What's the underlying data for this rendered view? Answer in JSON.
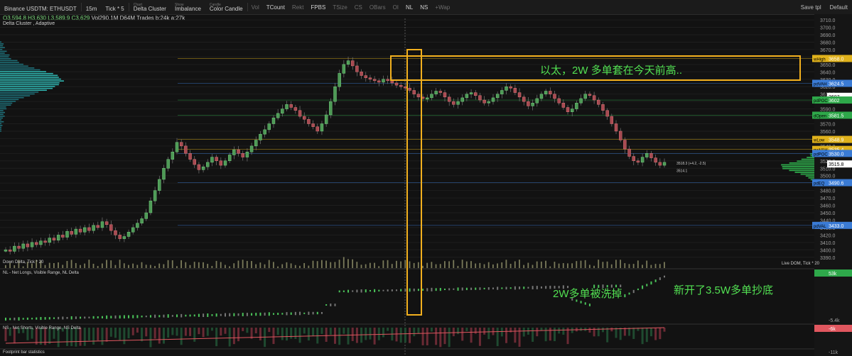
{
  "toolbar": {
    "symbol": "Binance USDTM: ETHUSDT",
    "interval": "15m",
    "tick": "Tick * 5",
    "chart_type_caption": "Chart",
    "chart_type": "Delta Cluster",
    "display_caption": "Show",
    "display": "Imbalance",
    "candle_caption": "Candle",
    "candle": "Color Candle",
    "flags": [
      "Vol",
      "TCount",
      "Rekt",
      "FPBS",
      "TSize",
      "CS",
      "OBars",
      "OI",
      "NL",
      "NS",
      "+Wap"
    ],
    "flags_active": [
      false,
      true,
      false,
      true,
      false,
      false,
      false,
      false,
      true,
      true,
      false
    ],
    "save_tpl": "Save tpl",
    "default": "Default"
  },
  "header": {
    "ohlc_o": "O3,594.8",
    "ohlc_h": "H3,630",
    "ohlc_l": "L3,589.9",
    "ohlc_c": "C3,629",
    "ohlc_vol": "Vol290.1M",
    "ohlc_d": "D64M",
    "ohlc_trades": "Trades b:24k a:27k",
    "study": "Delta Cluster , Adaptive"
  },
  "price_axis": {
    "ticks": [
      "3710.0",
      "3700.0",
      "3690.0",
      "3680.0",
      "3670.0",
      "3660.0",
      "3650.0",
      "3640.0",
      "3630.0",
      "3620.0",
      "3610.0",
      "3600.0",
      "3590.0",
      "3580.0",
      "3570.0",
      "3560.0",
      "3550.0",
      "3540.0",
      "3530.0",
      "3520.0",
      "3510.0",
      "3500.0",
      "3490.0",
      "3480.0",
      "3470.0",
      "3460.0",
      "3450.0",
      "3440.0",
      "3430.0",
      "3420.0",
      "3410.0",
      "3400.0",
      "3390.0"
    ],
    "labels": [
      {
        "text": "wHigh",
        "value": "3658.0",
        "price": 3658.0,
        "color": "#e0b21c"
      },
      {
        "text": "pdVAH",
        "value": "3624.5",
        "price": 3624.5,
        "color": "#3a7bd5"
      },
      {
        "text": "",
        "value": "3607",
        "price": 3607.0,
        "color": "#ffffff"
      },
      {
        "text": "pdPOC",
        "value": "3602",
        "price": 3602.0,
        "color": "#2ea84a"
      },
      {
        "text": "dOpen",
        "value": "3581.5",
        "price": 3581.5,
        "color": "#2ea84a"
      },
      {
        "text": "wLow",
        "value": "3548.9",
        "price": 3548.9,
        "color": "#e0b21c"
      },
      {
        "text": "pwVAH",
        "value": "3535.4",
        "price": 3535.4,
        "color": "#e0b21c"
      },
      {
        "text": "pdPOC",
        "value": "3530.0",
        "price": 3530.0,
        "color": "#3a7bd5"
      },
      {
        "text": "",
        "value": "3515.8",
        "price": 3515.8,
        "color": "#ffffff"
      },
      {
        "text": "pdEQ",
        "value": "3490.6",
        "price": 3490.6,
        "color": "#3a7bd5"
      },
      {
        "text": "pdVAL",
        "value": "3433.0",
        "price": 3433.0,
        "color": "#3a7bd5"
      }
    ],
    "last_readout": "3518.3 (+4.2, -2.5)",
    "low_readout": "3514.1"
  },
  "volume_pane": {
    "label": "Down Delta, Tick * 20",
    "dom_label": "Live DOM, Tick * 20"
  },
  "nl_pane": {
    "label": "NL - Net Longs, Visible Range, NL Delta",
    "value_top": "53k",
    "value_bottom": "-5.4k"
  },
  "ns_pane": {
    "label": "NS - Net Shorts, Visible Range, NS Delta",
    "value_top": "-6k",
    "value_bottom": "-11k"
  },
  "footer": {
    "label": "Footprint bar statistics"
  },
  "annotations": {
    "top_box_text": "以太，2W 多单套在今天前高..",
    "nl_text_1": "2W多单被洗掉",
    "nl_text_2": "新开了3.5W多单抄底",
    "box_color": "#f2b01e"
  },
  "colors": {
    "up": "#5fd16a",
    "down": "#e0575f",
    "bg": "#121212"
  },
  "chart_data": {
    "type": "candlestick",
    "y_range": [
      3385,
      3712
    ],
    "close_path": [
      3400,
      3398,
      3405,
      3402,
      3408,
      3404,
      3410,
      3407,
      3412,
      3410,
      3416,
      3413,
      3420,
      3417,
      3425,
      3421,
      3428,
      3424,
      3430,
      3426,
      3433,
      3430,
      3438,
      3434,
      3426,
      3420,
      3415,
      3418,
      3424,
      3430,
      3436,
      3442,
      3450,
      3466,
      3480,
      3495,
      3510,
      3522,
      3532,
      3545,
      3540,
      3530,
      3522,
      3515,
      3508,
      3512,
      3518,
      3525,
      3520,
      3514,
      3520,
      3528,
      3535,
      3530,
      3525,
      3532,
      3540,
      3548,
      3556,
      3562,
      3570,
      3578,
      3584,
      3590,
      3596,
      3592,
      3588,
      3580,
      3576,
      3570,
      3566,
      3560,
      3570,
      3582,
      3600,
      3620,
      3638,
      3650,
      3655,
      3648,
      3640,
      3635,
      3632,
      3630,
      3628,
      3626,
      3630,
      3628,
      3625,
      3622,
      3620,
      3618,
      3615,
      3610,
      3606,
      3604,
      3605,
      3610,
      3614,
      3612,
      3606,
      3600,
      3596,
      3600,
      3605,
      3610,
      3612,
      3608,
      3602,
      3598,
      3600,
      3605,
      3610,
      3615,
      3620,
      3618,
      3612,
      3606,
      3600,
      3594,
      3598,
      3604,
      3610,
      3614,
      3610,
      3604,
      3598,
      3592,
      3586,
      3590,
      3598,
      3604,
      3610,
      3608,
      3602,
      3596,
      3588,
      3580,
      3570,
      3560,
      3548,
      3536,
      3526,
      3520,
      3518,
      3525,
      3530,
      3524,
      3518,
      3514,
      3518
    ]
  }
}
